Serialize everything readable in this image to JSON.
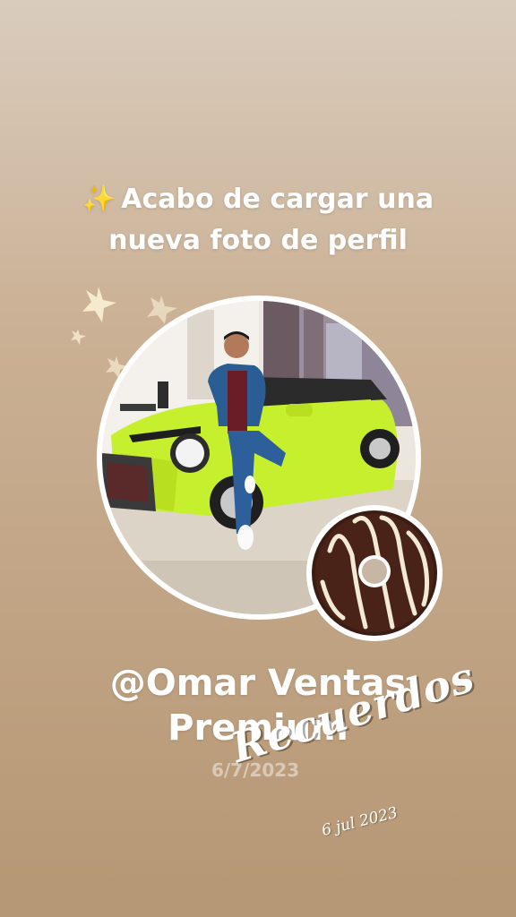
{
  "story": {
    "emoji": "✨",
    "headline_line1": "Acabo de cargar una",
    "headline_line2": "nueva foto de perfil",
    "username_line1": "@Omar Ventas",
    "username_line2": "Premium",
    "faded_date": "6/7/2023",
    "sticker_text": "Recuerdos",
    "memory_date": "6 jul 2023"
  },
  "colors": {
    "background_top": "#d9ccbd",
    "background_bottom": "#b69774",
    "car_body": "#c6ef2d",
    "donut_chocolate": "#4a2318",
    "text": "#ffffff"
  },
  "icons": {
    "sparkle": "sparkles-emoji",
    "stars": "star-sticker-icon",
    "donut": "chocolate-donut-sticker"
  }
}
